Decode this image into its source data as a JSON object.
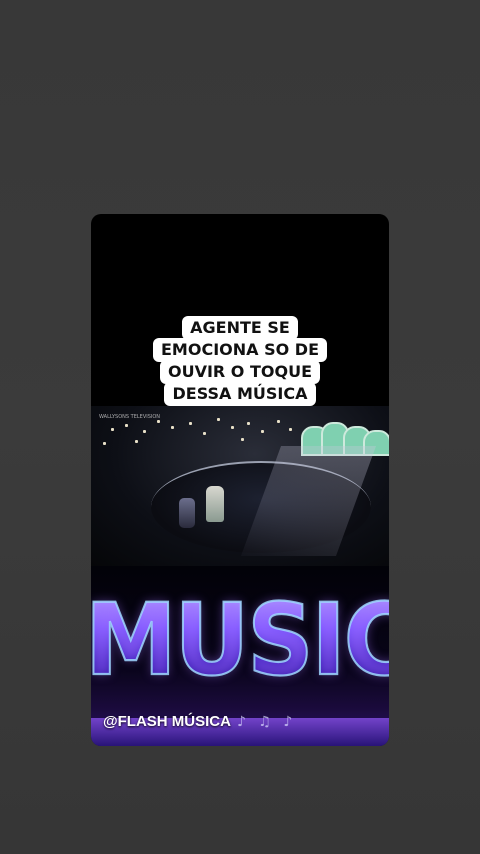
{
  "caption": {
    "lines": [
      "AGENTE SE",
      "EMOCIONA SO DE",
      "OUVIR O TOQUE",
      "DESSA MÚSICA"
    ]
  },
  "video": {
    "stamp": "WALLYSONS TELEVISION"
  },
  "banner": {
    "word": "MUSIC",
    "watermark": "@FLASH MÚSICA",
    "notes": "♪ ♫ ♪"
  },
  "colors": {
    "background": "#3a3a3a",
    "card": "#000000",
    "caption_bg": "#ffffff",
    "neon_purple": "#7b55ff",
    "neon_blue": "#9fd8ff"
  }
}
